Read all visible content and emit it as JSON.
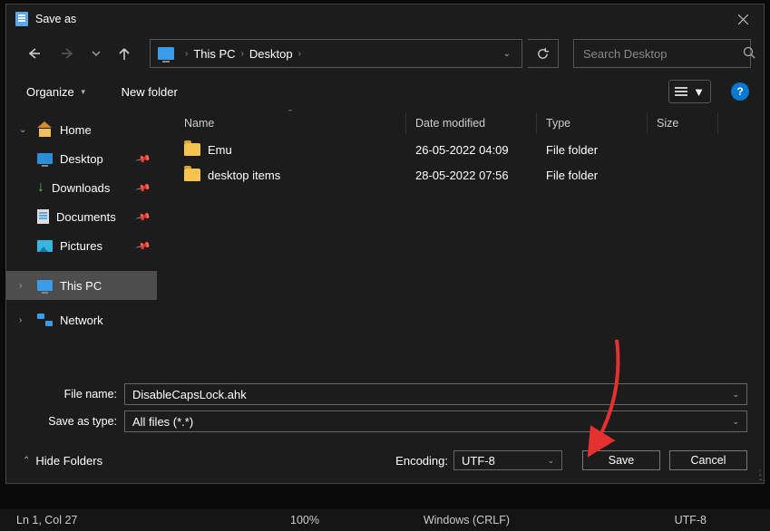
{
  "window": {
    "title": "Save as"
  },
  "nav": {
    "crumb1": "This PC",
    "crumb2": "Desktop",
    "search_placeholder": "Search Desktop"
  },
  "toolbar": {
    "organize": "Organize",
    "newfolder": "New folder"
  },
  "tree": {
    "home": "Home",
    "desktop": "Desktop",
    "downloads": "Downloads",
    "documents": "Documents",
    "pictures": "Pictures",
    "thispc": "This PC",
    "network": "Network"
  },
  "columns": {
    "name": "Name",
    "date": "Date modified",
    "type": "Type",
    "size": "Size"
  },
  "rows": [
    {
      "name": "Emu",
      "date": "26-05-2022 04:09",
      "type": "File folder"
    },
    {
      "name": "desktop items",
      "date": "28-05-2022 07:56",
      "type": "File folder"
    }
  ],
  "form": {
    "filename_label": "File name:",
    "filename_value": "DisableCapsLock.ahk",
    "type_label": "Save as type:",
    "type_value": "All files  (*.*)",
    "encoding_label": "Encoding:",
    "encoding_value": "UTF-8",
    "hide_folders": "Hide Folders",
    "save": "Save",
    "cancel": "Cancel"
  },
  "status": {
    "pos": "Ln 1, Col 27",
    "zoom": "100%",
    "eol": "Windows (CRLF)",
    "enc": "UTF-8"
  }
}
